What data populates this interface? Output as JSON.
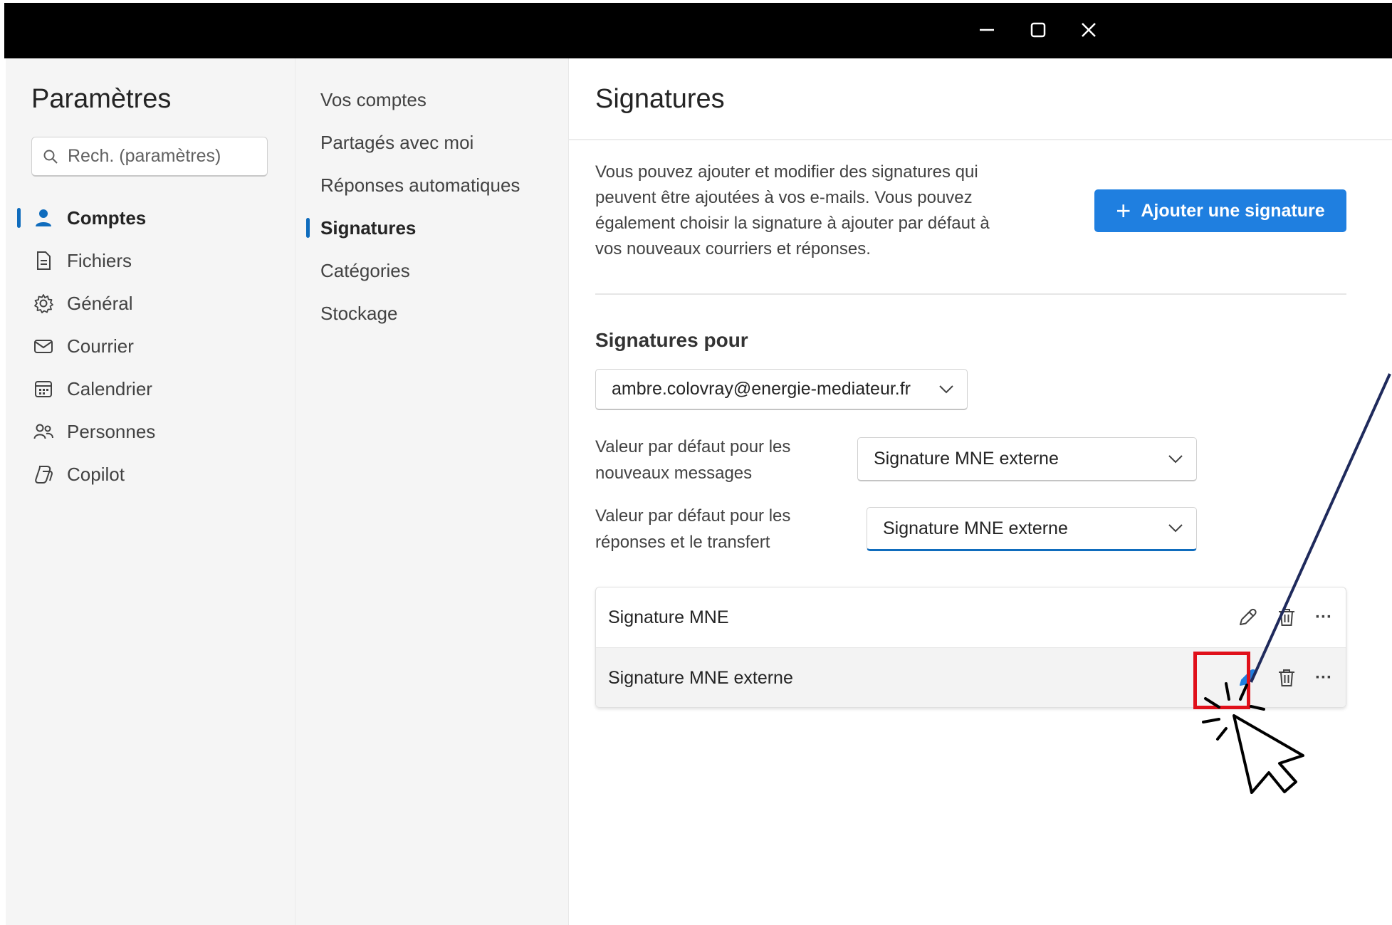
{
  "window": {
    "minimize_icon": "minimize-icon",
    "maximize_icon": "maximize-icon",
    "close_icon": "close-icon"
  },
  "sidebar": {
    "title": "Paramètres",
    "search_placeholder": "Rech. (paramètres)",
    "items": [
      {
        "label": "Comptes",
        "icon": "person-icon",
        "active": true
      },
      {
        "label": "Fichiers",
        "icon": "file-icon"
      },
      {
        "label": "Général",
        "icon": "gear-icon"
      },
      {
        "label": "Courrier",
        "icon": "mail-icon"
      },
      {
        "label": "Calendrier",
        "icon": "calendar-icon"
      },
      {
        "label": "Personnes",
        "icon": "people-icon"
      },
      {
        "label": "Copilot",
        "icon": "copilot-icon"
      }
    ]
  },
  "subnav": {
    "items": [
      {
        "label": "Vos comptes"
      },
      {
        "label": "Partagés avec moi"
      },
      {
        "label": "Réponses automatiques"
      },
      {
        "label": "Signatures",
        "active": true
      },
      {
        "label": "Catégories"
      },
      {
        "label": "Stockage"
      }
    ]
  },
  "main": {
    "title": "Signatures",
    "description": "Vous pouvez ajouter et modifier des signatures qui peuvent être ajoutées à vos e-mails. Vous pouvez également choisir la signature à ajouter par défaut à vos nouveaux courriers et réponses.",
    "add_button": "Ajouter une signature",
    "signatures_for_label": "Signatures pour",
    "account": "ambre.colovray@energie-mediateur.fr",
    "default_new_label": "Valeur par défaut pour les nouveaux messages",
    "default_new_value": "Signature MNE externe",
    "default_reply_label": "Valeur par défaut pour les réponses et le transfert",
    "default_reply_value": "Signature MNE externe",
    "signatures": [
      {
        "name": "Signature MNE"
      },
      {
        "name": "Signature MNE externe",
        "selected": true
      }
    ],
    "more_glyph": "···"
  },
  "annotation": {
    "highlight_color": "#e0101a",
    "arrow_color": "#1f2a5c",
    "cursor_icon": "pointer-cursor-icon"
  },
  "colors": {
    "accent": "#0f6cbd",
    "button": "#1f7fe0",
    "titlebar": "#000000",
    "pane": "#f5f5f5"
  }
}
